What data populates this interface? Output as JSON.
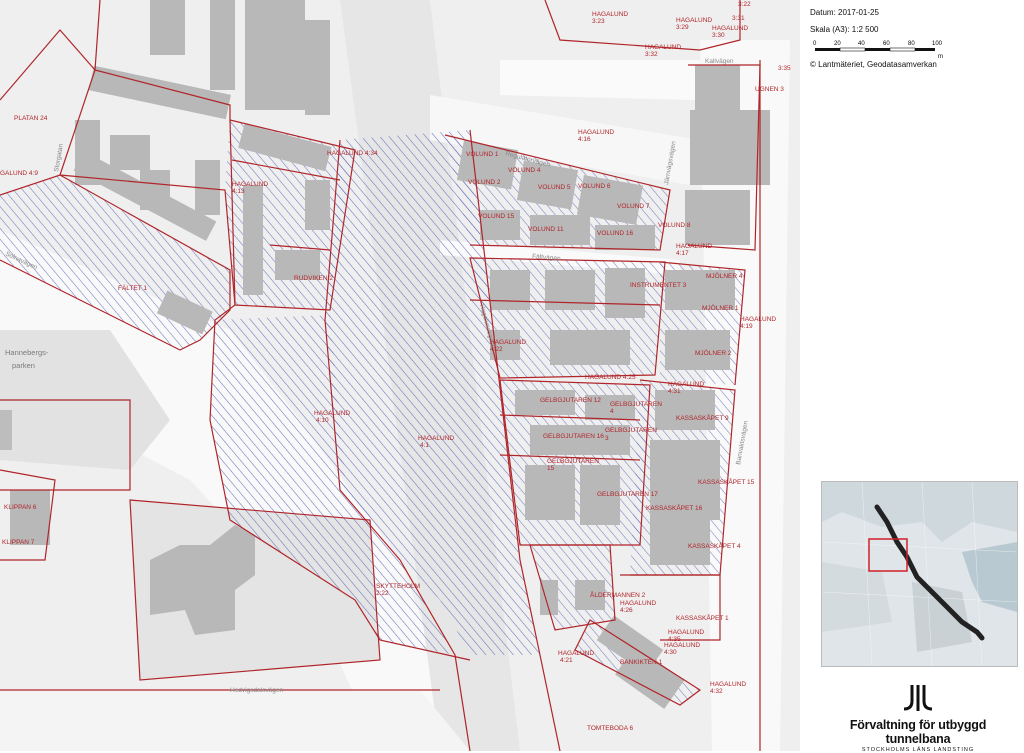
{
  "legend": {
    "date": "Datum: 2017-01-25",
    "scale": "Skala (A3): 1:2 500",
    "scale_ticks": [
      "0",
      "20",
      "40",
      "60",
      "80",
      "100"
    ],
    "scale_unit": "m",
    "copyright": "© Lantmäteriet, Geodatasamverkan"
  },
  "logo": {
    "title": "Förvaltning för utbyggd tunnelbana",
    "subtitle": "STOCKHOLMS LÄNS LANDSTING"
  },
  "colors": {
    "boundary": "#b0252a",
    "hatch": "#5865b8",
    "building": "#b8b8b8",
    "inset_highlight": "#d0202a",
    "inset_route": "#222222"
  },
  "map": {
    "parcels": [
      {
        "id": "hagalund-3-23",
        "text": [
          "HAGALUND",
          "3:23"
        ]
      },
      {
        "id": "hagalund-3-29",
        "text": [
          "HAGALUND",
          "3:29"
        ]
      },
      {
        "id": "hagalund-3-22",
        "text": [
          "3:22"
        ]
      },
      {
        "id": "hagalund-3-31",
        "text": [
          "3:31"
        ]
      },
      {
        "id": "hagalund-3-30",
        "text": [
          "HAGALUND",
          "3:30"
        ]
      },
      {
        "id": "hagalund-3-32",
        "text": [
          "HAGALUND",
          "3:32"
        ]
      },
      {
        "id": "hagalund-3-35",
        "text": [
          "3:35"
        ]
      },
      {
        "id": "ugnen-3",
        "text": [
          "UGNEN 3"
        ]
      },
      {
        "id": "platan-24",
        "text": [
          "PLATAN 24"
        ]
      },
      {
        "id": "hagalund-4-34",
        "text": [
          "HAGALUND 4:34"
        ]
      },
      {
        "id": "hagalund-4-9",
        "text": [
          "GALUND 4:9"
        ]
      },
      {
        "id": "hagalund-4-16",
        "text": [
          "HAGALUND",
          "4:16"
        ]
      },
      {
        "id": "volund-1",
        "text": [
          "VOLUND 1"
        ]
      },
      {
        "id": "volund-2",
        "text": [
          "VOLUND 2"
        ]
      },
      {
        "id": "volund-4",
        "text": [
          "VOLUND 4"
        ]
      },
      {
        "id": "volund-5",
        "text": [
          "VOLUND 5"
        ]
      },
      {
        "id": "volund-6",
        "text": [
          "VOLUND 6"
        ]
      },
      {
        "id": "volund-7",
        "text": [
          "VOLUND 7"
        ]
      },
      {
        "id": "volund-8",
        "text": [
          "VOLUND 8"
        ]
      },
      {
        "id": "volund-15",
        "text": [
          "VOLUND 15"
        ]
      },
      {
        "id": "volund-11",
        "text": [
          "VOLUND 11"
        ]
      },
      {
        "id": "volund-16",
        "text": [
          "VOLUND 16"
        ]
      },
      {
        "id": "hagalund-4-17",
        "text": [
          "HAGALUND",
          "4:17"
        ]
      },
      {
        "id": "hagalund-4-13",
        "text": [
          "HAGALUND",
          "4:13"
        ]
      },
      {
        "id": "rudviken-2",
        "text": [
          "RUDVIKEN 2"
        ]
      },
      {
        "id": "faltet-1",
        "text": [
          "FÄLTET 1"
        ]
      },
      {
        "id": "instrumentet-3",
        "text": [
          "INSTRUMENTET 3"
        ]
      },
      {
        "id": "mjolner-4",
        "text": [
          "MJÖLNER 4"
        ]
      },
      {
        "id": "mjolner-1",
        "text": [
          "MJÖLNER 1"
        ]
      },
      {
        "id": "mjolner-2",
        "text": [
          "MJÖLNER 2"
        ]
      },
      {
        "id": "hagalund-4-19",
        "text": [
          "HAGALUND",
          "4:19"
        ]
      },
      {
        "id": "hagalund-4-22",
        "text": [
          "HAGALUND",
          "4:22"
        ]
      },
      {
        "id": "hagalund-4-25",
        "text": [
          "HAGALUND 4:25"
        ]
      },
      {
        "id": "hagalund-4-31",
        "text": [
          "HAGALUND",
          "4:31"
        ]
      },
      {
        "id": "gelbgjutaren-12",
        "text": [
          "GELBGJUTAREN 12"
        ]
      },
      {
        "id": "gelbgjutaren-4",
        "text": [
          "GELBGJUTAREN",
          "4"
        ]
      },
      {
        "id": "gelbgjutaren-16",
        "text": [
          "GELBGJUTAREN 16"
        ]
      },
      {
        "id": "gelbgjutaren-3",
        "text": [
          "3"
        ]
      },
      {
        "id": "gelbgjutaren-15",
        "text": [
          "GELBGJUTAREN",
          "15"
        ]
      },
      {
        "id": "gelbgjutaren-5",
        "text": [
          "GELBGJUTAREN"
        ]
      },
      {
        "id": "gelbgjutaren-17",
        "text": [
          "GELBGJUTAREN 17"
        ]
      },
      {
        "id": "kassaskapet-9",
        "text": [
          "KASSASKÅPET 9"
        ]
      },
      {
        "id": "kassaskapet-15",
        "text": [
          "KASSASKÅPET 15"
        ]
      },
      {
        "id": "kassaskapet-16",
        "text": [
          "KASSASKÅPET 16"
        ]
      },
      {
        "id": "kassaskapet-4",
        "text": [
          "KASSASKÅPET 4"
        ]
      },
      {
        "id": "kassaskapet-1",
        "text": [
          "KASSASKÅPET 1"
        ]
      },
      {
        "id": "hagalund-4-10",
        "text": [
          "HAGALUND",
          "4:10"
        ]
      },
      {
        "id": "hagalund-4-1",
        "text": [
          "HAGALUND",
          "4:1"
        ]
      },
      {
        "id": "hagalund-4-21",
        "text": [
          "HAGALUND",
          "4:21"
        ]
      },
      {
        "id": "skyttenolm-2-22",
        "text": [
          "SKYTTEHOLM",
          "2:22"
        ]
      },
      {
        "id": "aldermannen-2",
        "text": [
          "ÅLDERMANNEN 2"
        ]
      },
      {
        "id": "hagalund-4-26",
        "text": [
          "HAGALUND",
          "4:26"
        ]
      },
      {
        "id": "hagalund-4-35",
        "text": [
          "HAGALUND",
          "4:35"
        ]
      },
      {
        "id": "hagalund-4-30",
        "text": [
          "HAGALUND",
          "4:30"
        ]
      },
      {
        "id": "bankiren-1",
        "text": [
          "BANKIKTEN 1"
        ]
      },
      {
        "id": "hagalund-4-32",
        "text": [
          "HAGALUND",
          "4:32"
        ]
      },
      {
        "id": "tomteboda-6",
        "text": [
          "TOMTEBODA 6"
        ]
      },
      {
        "id": "klippan-6",
        "text": [
          "KLIPPAN 6"
        ]
      },
      {
        "id": "klippan-7",
        "text": [
          "KLIPPAN 7"
        ]
      }
    ],
    "streets": [
      {
        "id": "kallvagen",
        "text": "Kallvägen"
      },
      {
        "id": "regulatorvagen",
        "text": "Regulatorvägen"
      },
      {
        "id": "jarnvagen",
        "text": "Järnvägsvägen"
      },
      {
        "id": "faltvagen",
        "text": "Fältvägen"
      },
      {
        "id": "solnavagen",
        "text": "Solnavägen"
      },
      {
        "id": "storgatan",
        "text": "Storgatan"
      },
      {
        "id": "hagalundsgatan",
        "text": "Hagalundsgatan"
      },
      {
        "id": "banvaktsvagen",
        "text": "Banvaktsvägen"
      },
      {
        "id": "hedvigsdalsvagen",
        "text": "Hedvigsdalsvägen"
      },
      {
        "id": "hannebergs-parken",
        "text": [
          "Hannebergs-",
          "parken"
        ]
      }
    ]
  }
}
